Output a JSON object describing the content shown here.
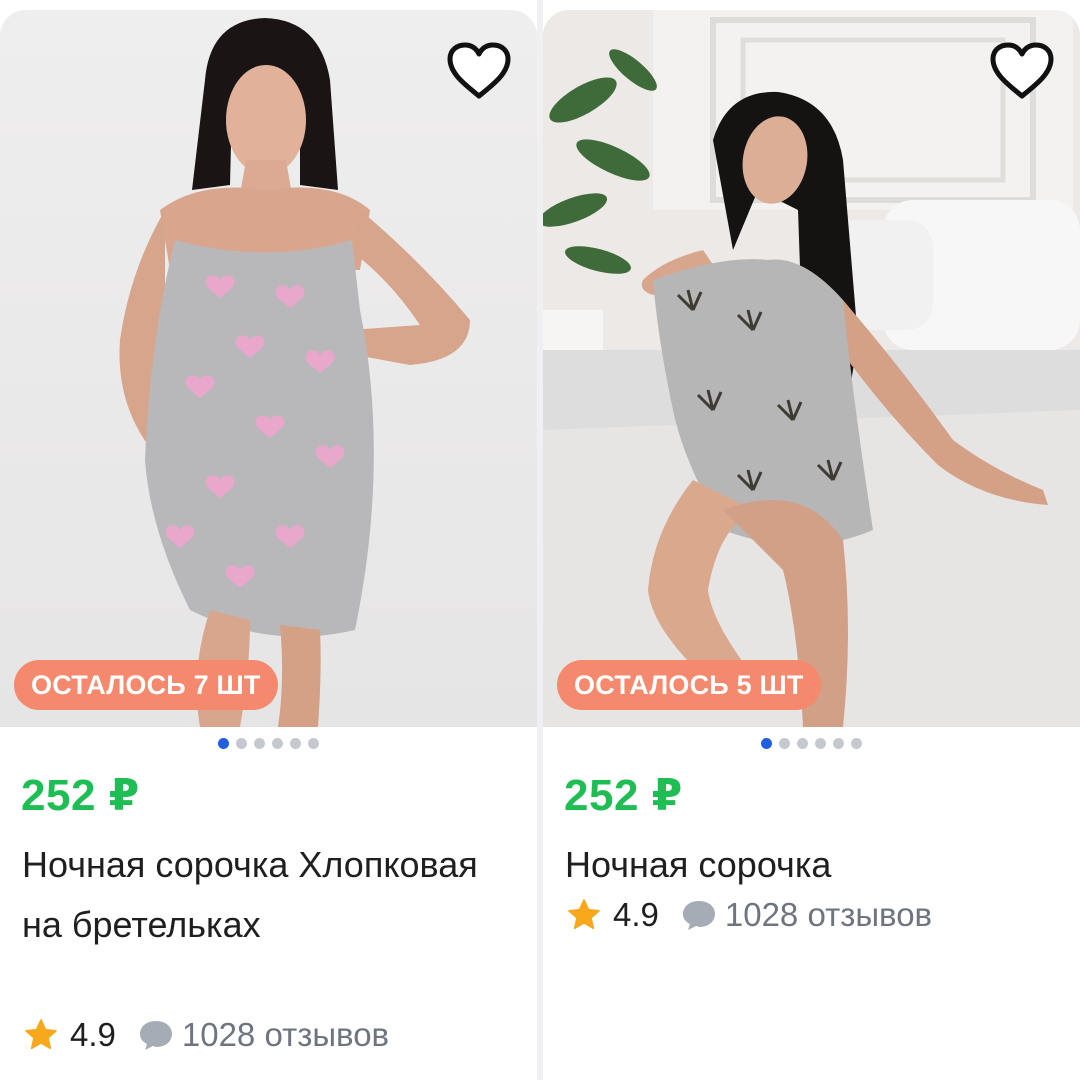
{
  "products": [
    {
      "badge": "ОСТАЛОСЬ 7 ШТ",
      "price": "252 ₽",
      "title": "Ночная сорочка Хлопковая на бретельках",
      "rating": "4.9",
      "reviews": "1028 отзывов",
      "carousel_total": 6,
      "carousel_active": 1
    },
    {
      "badge": "ОСТАЛОСЬ 5 ШТ",
      "price": "252 ₽",
      "title": "Ночная сорочка",
      "rating": "4.9",
      "reviews": "1028 отзывов",
      "carousel_total": 6,
      "carousel_active": 1
    }
  ],
  "colors": {
    "price": "#1fbe55",
    "badge": "#f4896d",
    "rating_star": "#f7a81b",
    "carousel_active": "#1f5fe0"
  },
  "icons": [
    "heart-outline-icon",
    "star-icon",
    "comment-bubble-icon"
  ]
}
